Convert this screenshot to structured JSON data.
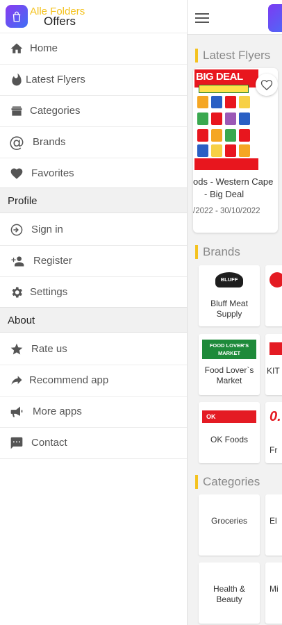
{
  "app": {
    "name": "Alle Folders",
    "subtitle": "Offers"
  },
  "drawer": {
    "main_items": [
      {
        "label": "Home",
        "icon": "home-icon"
      },
      {
        "label": "Latest Flyers",
        "icon": "flame-icon"
      },
      {
        "label": "Categories",
        "icon": "box-icon"
      },
      {
        "label": "Brands",
        "icon": "at-sign-icon"
      },
      {
        "label": "Favorites",
        "icon": "heart-icon"
      }
    ],
    "profile_label": "Profile",
    "profile_items": [
      {
        "label": "Sign in",
        "icon": "sign-in-icon"
      },
      {
        "label": "Register",
        "icon": "add-user-icon"
      },
      {
        "label": "Settings",
        "icon": "gear-icon"
      }
    ],
    "about_label": "About",
    "about_items": [
      {
        "label": "Rate us",
        "icon": "star-icon"
      },
      {
        "label": "Recommend app",
        "icon": "share-arrow-icon"
      },
      {
        "label": "More apps",
        "icon": "megaphone-icon"
      },
      {
        "label": "Contact",
        "icon": "chat-icon"
      }
    ]
  },
  "main": {
    "latest_flyers_title": "Latest Flyers",
    "flyer": {
      "image_text": "BIG DEAL",
      "title_line1": "ods - Western Cape",
      "title_line2": "- Big Deal",
      "date": "/2022 - 30/10/2022"
    },
    "brands_title": "Brands",
    "brands": [
      {
        "name": "Bluff Meat Supply",
        "logo_text": "BLUFF"
      },
      {
        "name": "Food Lover`s Market",
        "logo_text": "FOOD LOVER'S MARKET"
      },
      {
        "name": "OK Foods",
        "logo_text": "OK"
      }
    ],
    "brands_partial": [
      "KIT",
      "Fr"
    ],
    "categories_title": "Categories",
    "categories": [
      "Groceries",
      "Health & Beauty"
    ],
    "categories_partial": [
      "El",
      "Mi"
    ]
  },
  "colors": {
    "accent": "#f4c21f",
    "brand_purple": "#7c3bf2",
    "flyer_red": "#e8161e"
  }
}
